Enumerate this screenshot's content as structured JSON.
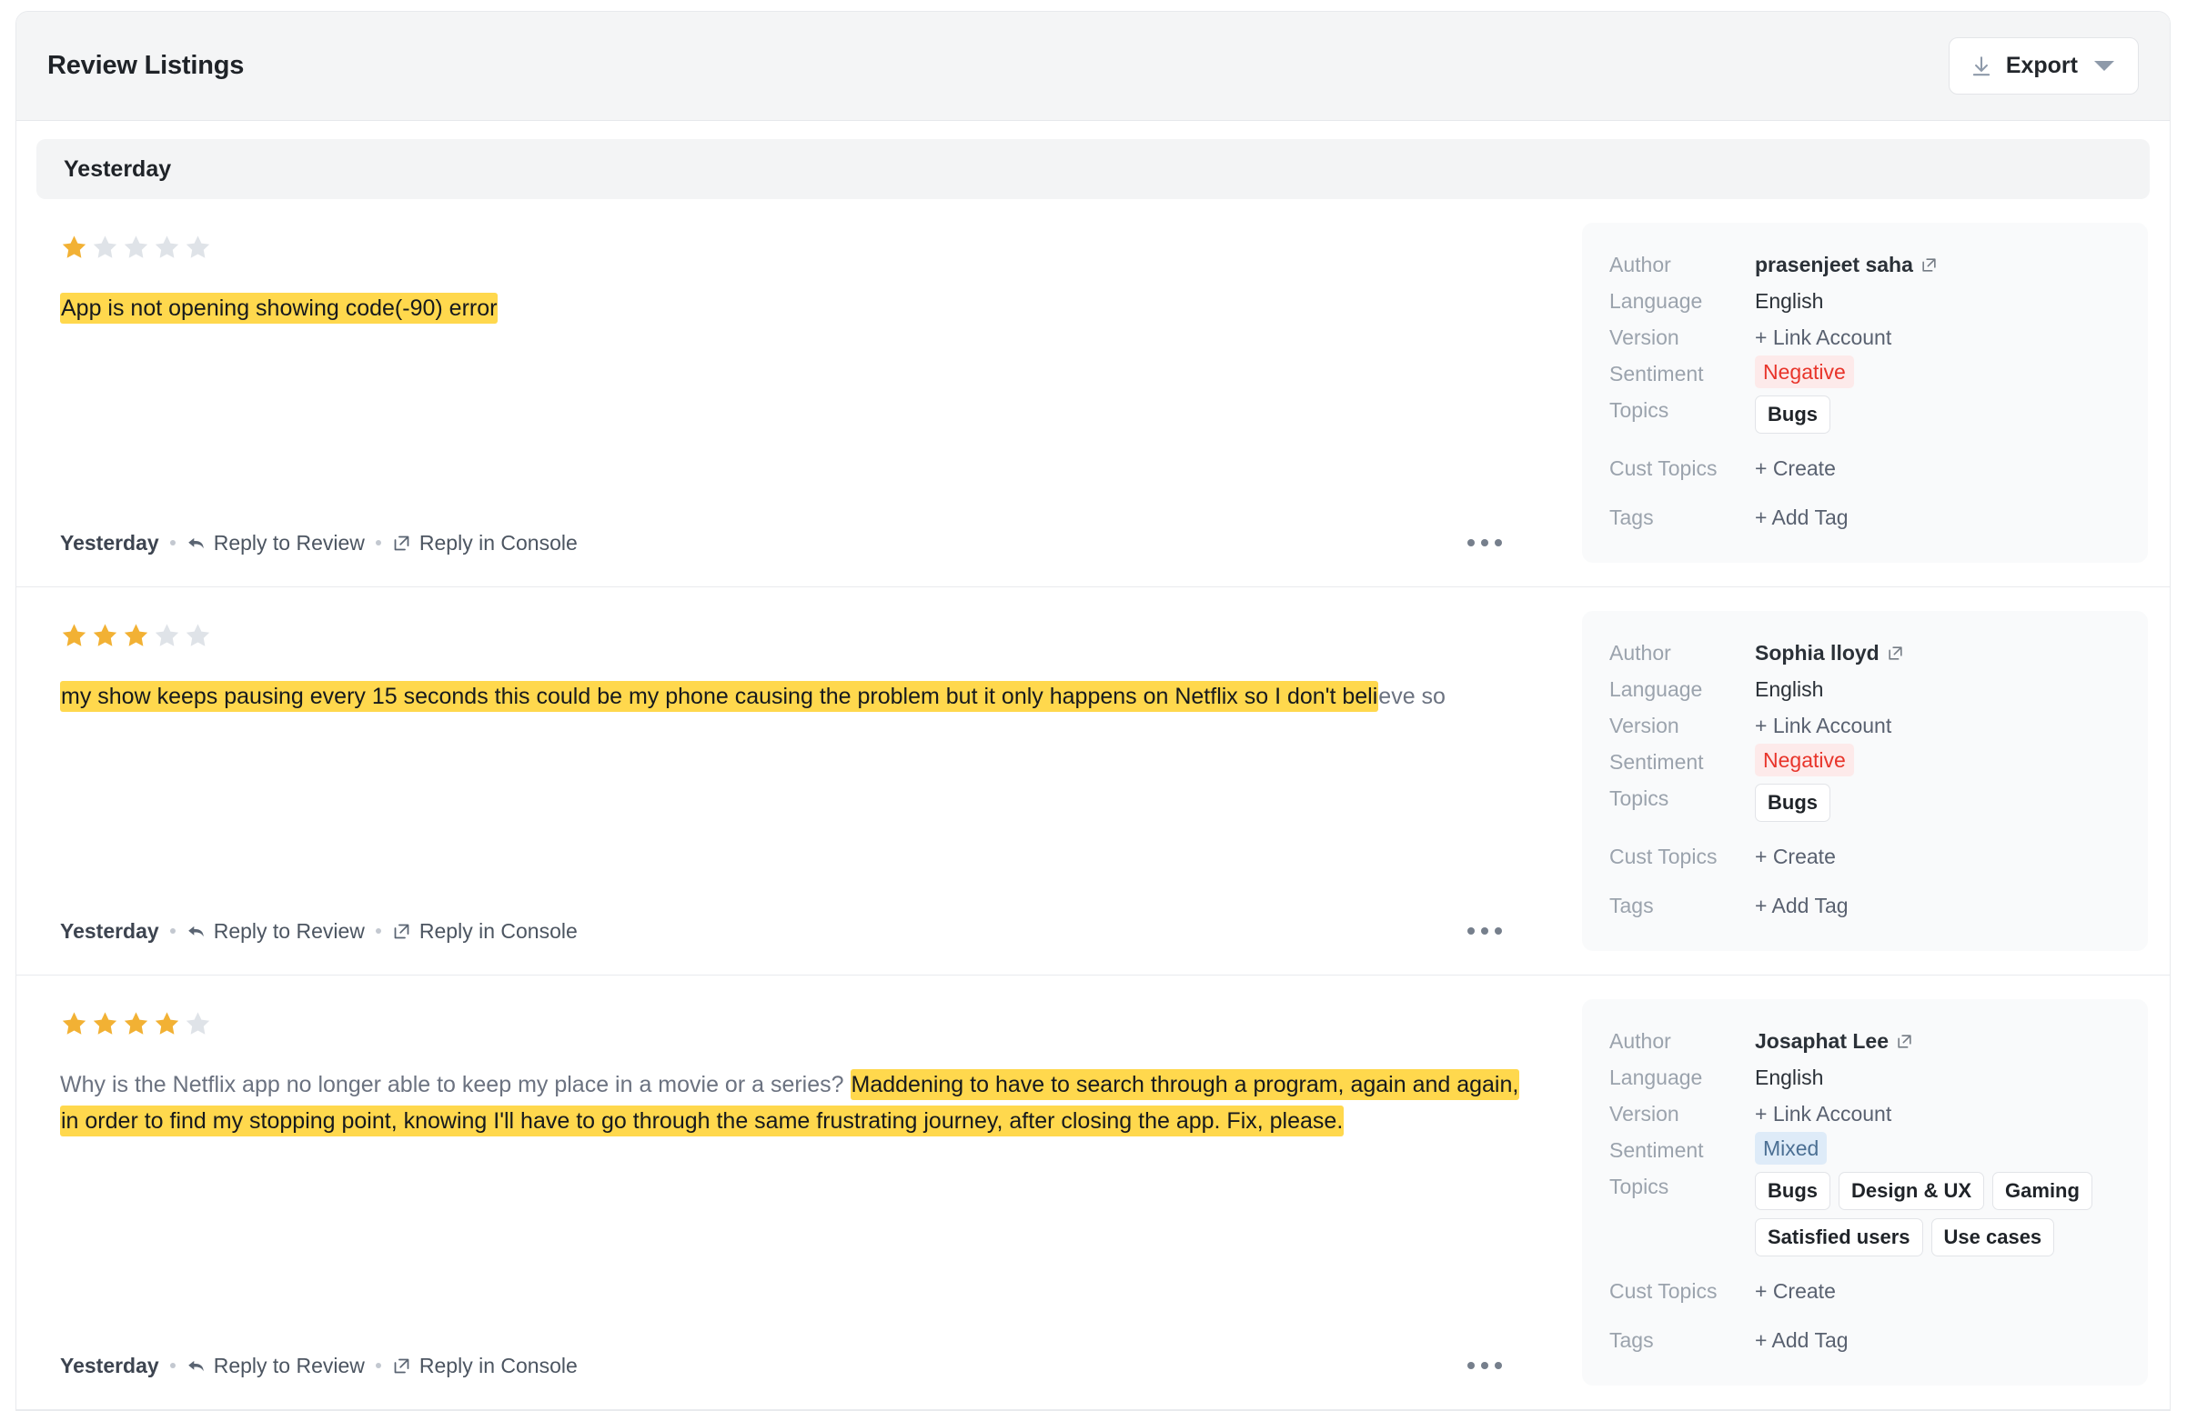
{
  "header": {
    "title": "Review Listings",
    "export_label": "Export",
    "download_icon": "download-icon",
    "caret_icon": "chevron-down-icon"
  },
  "group": {
    "label": "Yesterday"
  },
  "labels": {
    "author": "Author",
    "language": "Language",
    "version": "Version",
    "sentiment": "Sentiment",
    "topics": "Topics",
    "cust_topics": "Cust Topics",
    "tags": "Tags",
    "link_account": "+ Link Account",
    "create": "+ Create",
    "add_tag": "+ Add Tag",
    "reply_to_review": "Reply to Review",
    "reply_in_console": "Reply in Console",
    "timestamp": "Yesterday",
    "more_actions": "more-actions"
  },
  "colors": {
    "highlight": "#ffd84d",
    "star_filled": "#f2b134",
    "star_empty": "#dfe3e8",
    "negative_text": "#e8342a",
    "negative_bg": "#fdeaea",
    "mixed_text": "#4b6f93",
    "mixed_bg": "#deebf8",
    "panel_bg": "#f9fafb",
    "header_bg": "#f4f5f6"
  },
  "reviews": [
    {
      "rating": 1,
      "segments": [
        {
          "text": "App is not opening showing code(-90) error",
          "highlight": true
        }
      ],
      "author": "prasenjeet saha",
      "language": "English",
      "version": "+ Link Account",
      "sentiment": "Negative",
      "sentiment_kind": "negative",
      "topics": [
        "Bugs"
      ],
      "cust_topics": "+ Create",
      "tags": "+ Add Tag",
      "timestamp": "Yesterday"
    },
    {
      "rating": 3,
      "segments": [
        {
          "text": "my show keeps pausing every 15 seconds this could be my phone causing the problem but it only happens on Netflix so I don't beli",
          "highlight": true
        },
        {
          "text": "eve so",
          "highlight": false
        }
      ],
      "author": "Sophia lloyd",
      "language": "English",
      "version": "+ Link Account",
      "sentiment": "Negative",
      "sentiment_kind": "negative",
      "topics": [
        "Bugs"
      ],
      "cust_topics": "+ Create",
      "tags": "+ Add Tag",
      "timestamp": "Yesterday"
    },
    {
      "rating": 4,
      "segments": [
        {
          "text": "Why is the Netflix app no longer able to keep my place in a movie or a series? ",
          "highlight": false
        },
        {
          "text": "Maddening to have to search through a program, again and again, in order to find my stopping point, knowing I'll have to go through the same frustrating journey, after closing the app. Fix, please.",
          "highlight": true
        }
      ],
      "author": "Josaphat Lee",
      "language": "English",
      "version": "+ Link Account",
      "sentiment": "Mixed",
      "sentiment_kind": "mixed",
      "topics": [
        "Bugs",
        "Design & UX",
        "Gaming",
        "Satisfied users",
        "Use cases"
      ],
      "cust_topics": "+ Create",
      "tags": "+ Add Tag",
      "timestamp": "Yesterday"
    }
  ]
}
